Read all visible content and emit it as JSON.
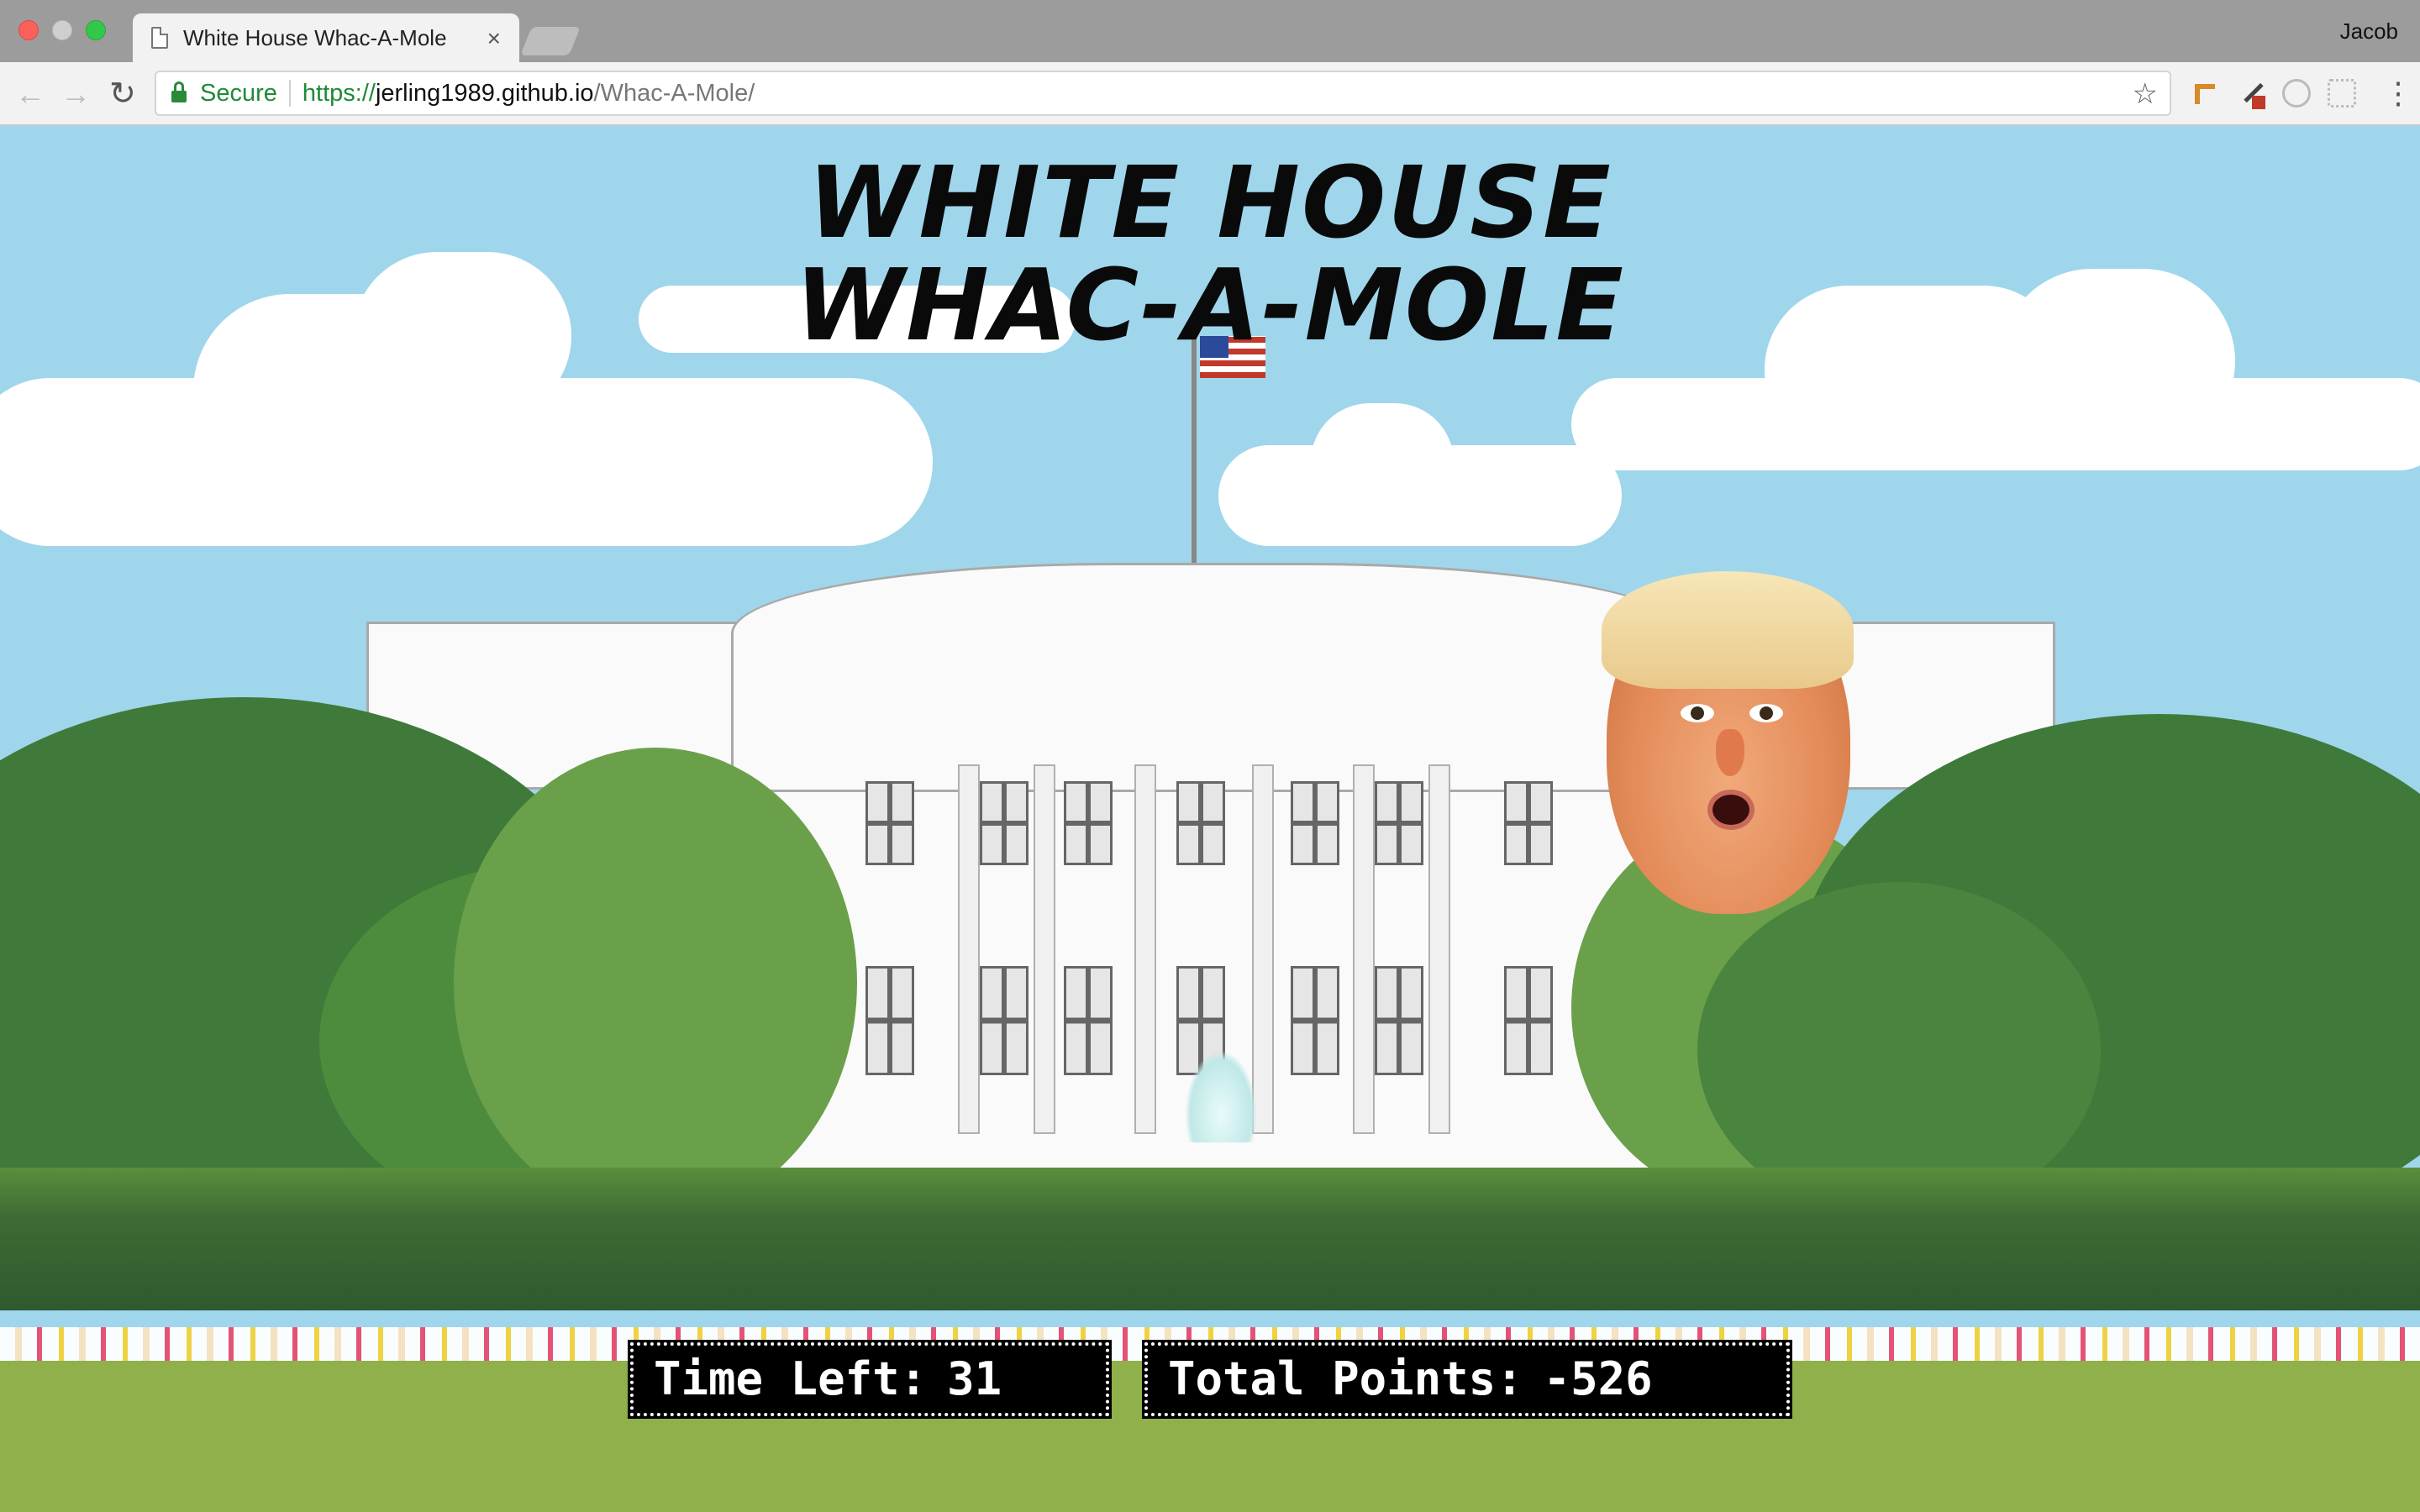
{
  "browser": {
    "tab_title": "White House Whac-A-Mole",
    "tab_close": "×",
    "profile_name": "Jacob",
    "secure_label": "Secure",
    "url_scheme": "https://",
    "url_host": "jerling1989.github.io",
    "url_path": "/Whac-A-Mole/",
    "back_icon": "←",
    "forward_icon": "→",
    "reload_icon": "↻",
    "star_icon": "☆",
    "menu_icon": "⋮"
  },
  "game": {
    "title_line1": "WHITE HOUSE",
    "title_line2": "WHAC-A-MOLE",
    "time_label": "Time Left:",
    "time_value": "31",
    "points_label": "Total Points:",
    "points_value": "-526"
  },
  "colors": {
    "sky": "#9fd6ec",
    "lawn": "#8fb04a",
    "hedge": "#3e6a34",
    "secure_green": "#1e8a36"
  }
}
